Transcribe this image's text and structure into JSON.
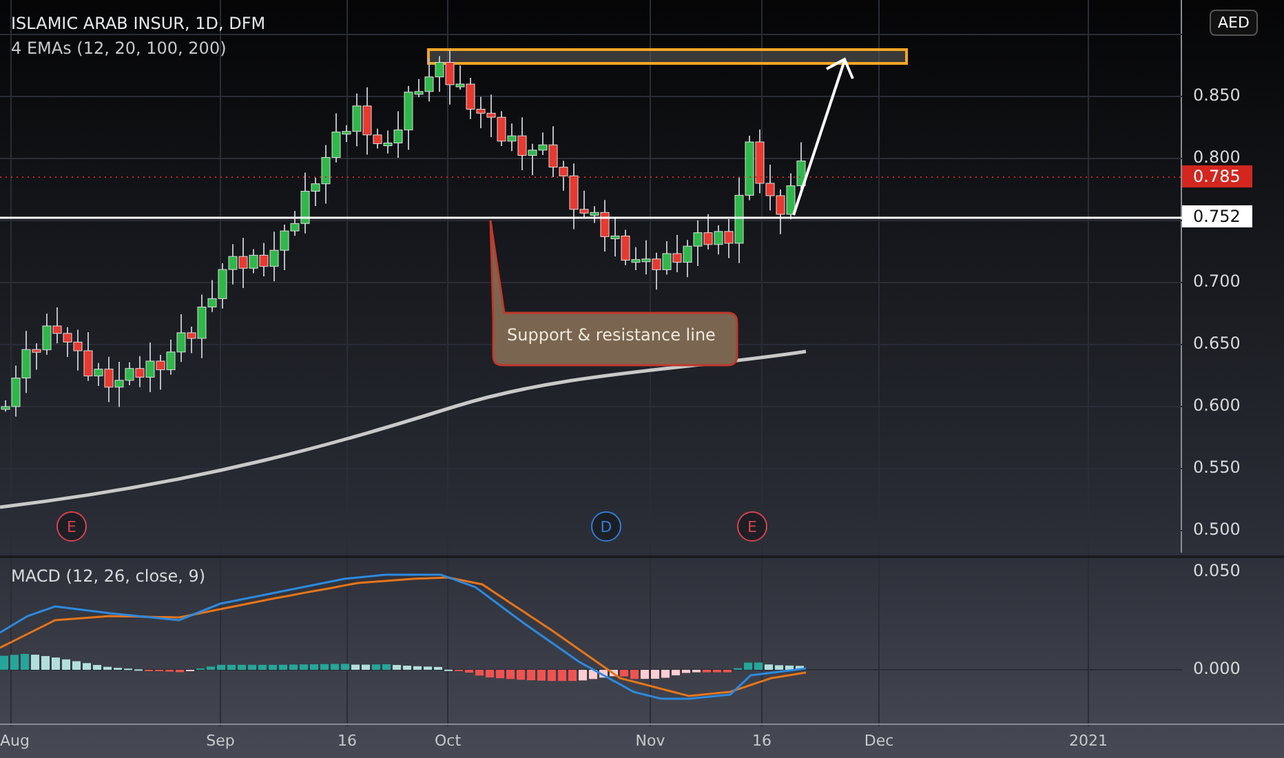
{
  "header": {
    "symbol_title": "ISLAMIC ARAB INSUR, 1D, DFM",
    "indicator": "4 EMAs (12, 20, 100, 200)"
  },
  "currency": "AED",
  "price_axis": {
    "ticks": [
      "0.850",
      "0.800",
      "0.700",
      "0.650",
      "0.600",
      "0.550",
      "0.500"
    ]
  },
  "price_labels": [
    {
      "text": "0.785",
      "kind": "last"
    },
    {
      "text": "0.752",
      "kind": "line"
    }
  ],
  "annotation": {
    "text": "Support & resistance line"
  },
  "events": [
    {
      "letter": "E",
      "color": "#d9434f"
    },
    {
      "letter": "D",
      "color": "#2f7fd8"
    },
    {
      "letter": "E",
      "color": "#d9434f"
    }
  ],
  "macd": {
    "title": "MACD (12, 26, close, 9)",
    "ticks": [
      "0.050",
      "0.000"
    ]
  },
  "time_axis": {
    "labels": [
      "Aug",
      "Sep",
      "16",
      "Oct",
      "Nov",
      "16",
      "Dec",
      "2021"
    ]
  }
}
